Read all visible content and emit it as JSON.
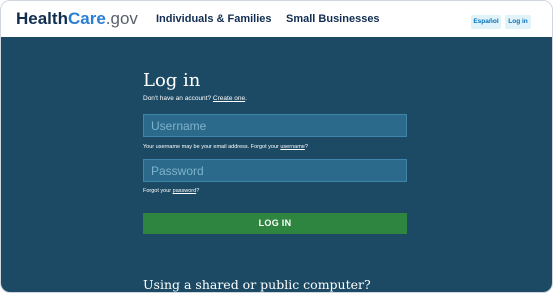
{
  "header": {
    "logo": {
      "health": "Health",
      "care": "Care",
      "gov": ".gov"
    },
    "nav": [
      {
        "label": "Individuals & Families"
      },
      {
        "label": "Small Businesses"
      }
    ],
    "espanol_label": "Español",
    "login_label": "Log in"
  },
  "login": {
    "title": "Log in",
    "no_account_text": "Don't have an account?",
    "create_link": "Create one",
    "period": ".",
    "username_placeholder": "Username",
    "username_hint": "Your username may be your email address. Forgot your",
    "username_link": "username",
    "username_hint_end": "?",
    "password_placeholder": "Password",
    "password_hint": "Forgot your",
    "password_link": "password",
    "password_hint_end": "?",
    "button_label": "LOG IN",
    "shared_computer_heading": "Using a shared or public computer?"
  },
  "colors": {
    "brand_dark": "#112e51",
    "brand_blue": "#2a7fd2",
    "background": "#1c4a64",
    "field": "#2b6a8a",
    "button": "#2e8540"
  }
}
